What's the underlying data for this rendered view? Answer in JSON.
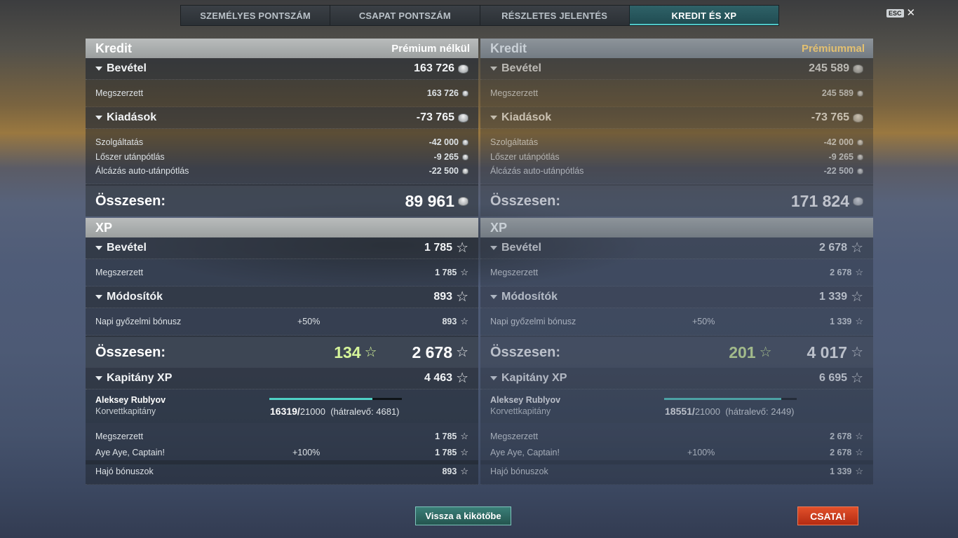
{
  "tabs": [
    {
      "label": "SZEMÉLYES PONTSZÁM"
    },
    {
      "label": "CSAPAT PONTSZÁM"
    },
    {
      "label": "RÉSZLETES JELENTÉS"
    },
    {
      "label": "KREDIT ÉS XP"
    }
  ],
  "esc": {
    "label": "ESC",
    "close": "✕"
  },
  "left": {
    "credit_title": "Kredit",
    "mode": "Prémium nélkül",
    "income_label": "Bevétel",
    "income_value": "163 726",
    "earned_label": "Megszerzett",
    "earned_value": "163 726",
    "expenses_label": "Kiadások",
    "expenses_value": "-73 765",
    "service_label": "Szolgáltatás",
    "service_value": "-42 000",
    "ammo_label": "Lőszer utánpótlás",
    "ammo_value": "-9 265",
    "camo_label": "Álcázás auto-utánpótlás",
    "camo_value": "-22 500",
    "total_label": "Összesen:",
    "credit_total": "89 961",
    "xp_title": "XP",
    "xp_income_label": "Bevétel",
    "xp_income_value": "1 785",
    "xp_earned_label": "Megszerzett",
    "xp_earned_value": "1 785",
    "mod_label": "Módosítók",
    "mod_value": "893",
    "daily_label": "Napi győzelmi bónusz",
    "daily_mult": "+50%",
    "daily_value": "893",
    "xp_total_label": "Összesen:",
    "xp_free": "134",
    "xp_total": "2 678",
    "capt_label": "Kapitány XP",
    "capt_value": "4 463",
    "capt_name": "Aleksey Rublyov",
    "capt_rank": "Korvettkapitány",
    "capt_progress": 0.777,
    "capt_cur": "16319/",
    "capt_max": "21000",
    "capt_remaining": "(hátralevő: 4681)",
    "c_earned_label": "Megszerzett",
    "c_earned_value": "1 785",
    "aye_label": "Aye Aye, Captain!",
    "aye_mult": "+100%",
    "aye_value": "1 785",
    "ship_label": "Hajó bónuszok",
    "ship_value": "893"
  },
  "right": {
    "credit_title": "Kredit",
    "mode": "Prémiummal",
    "income_label": "Bevétel",
    "income_value": "245 589",
    "earned_label": "Megszerzett",
    "earned_value": "245 589",
    "expenses_label": "Kiadások",
    "expenses_value": "-73 765",
    "service_label": "Szolgáltatás",
    "service_value": "-42 000",
    "ammo_label": "Lőszer utánpótlás",
    "ammo_value": "-9 265",
    "camo_label": "Álcázás auto-utánpótlás",
    "camo_value": "-22 500",
    "total_label": "Összesen:",
    "credit_total": "171 824",
    "xp_title": "XP",
    "xp_income_label": "Bevétel",
    "xp_income_value": "2 678",
    "xp_earned_label": "Megszerzett",
    "xp_earned_value": "2 678",
    "mod_label": "Módosítók",
    "mod_value": "1 339",
    "daily_label": "Napi győzelmi bónusz",
    "daily_mult": "+50%",
    "daily_value": "1 339",
    "xp_total_label": "Összesen:",
    "xp_free": "201",
    "xp_total": "4 017",
    "capt_label": "Kapitány XP",
    "capt_value": "6 695",
    "capt_name": "Aleksey Rublyov",
    "capt_rank": "Korvettkapitány",
    "capt_progress": 0.883,
    "capt_cur": "18551/",
    "capt_max": "21000",
    "capt_remaining": "(hátralevő: 2449)",
    "c_earned_label": "Megszerzett",
    "c_earned_value": "2 678",
    "aye_label": "Aye Aye, Captain!",
    "aye_mult": "+100%",
    "aye_value": "2 678",
    "ship_label": "Hajó bónuszok",
    "ship_value": "1 339"
  },
  "buttons": {
    "back": "Vissza a kikötőbe",
    "battle": "CSATA!"
  },
  "icons": {
    "coin": "credit-coin-icon",
    "star": "xp-star-icon",
    "collapse": "triangle-down-icon"
  }
}
